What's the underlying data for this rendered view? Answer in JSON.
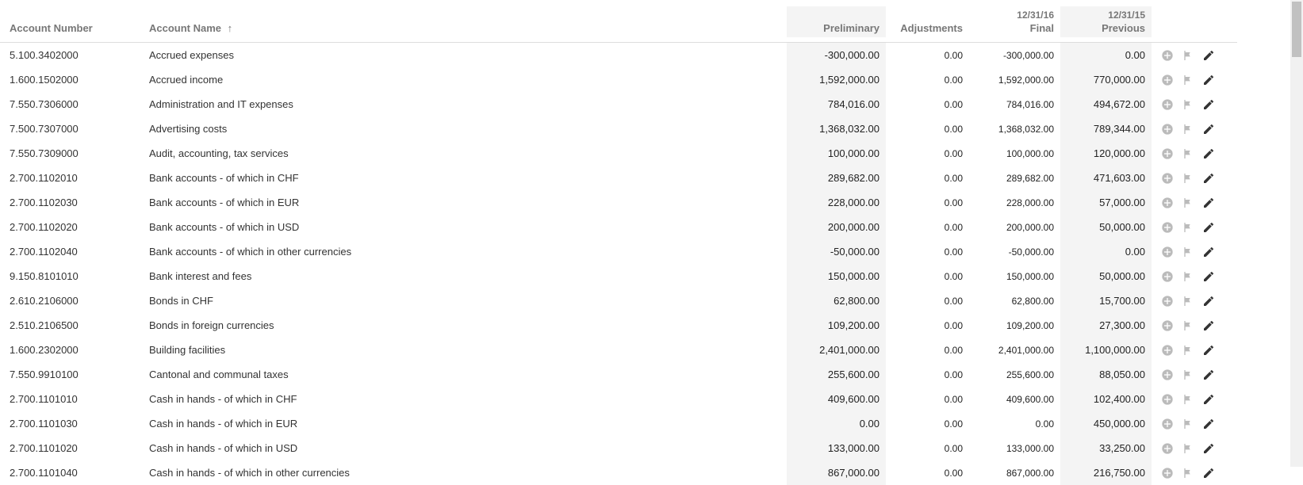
{
  "columns": {
    "account_number": "Account Number",
    "account_name": "Account Name",
    "preliminary": "Preliminary",
    "adjustments": "Adjustments",
    "final_super": "12/31/16",
    "final": "Final",
    "previous_super": "12/31/15",
    "previous": "Previous"
  },
  "sort": {
    "column": "account_name",
    "direction": "asc"
  },
  "rows": [
    {
      "num": "5.100.3402000",
      "name": "Accrued expenses",
      "prelim": "-300,000.00",
      "adj": "0.00",
      "final": "-300,000.00",
      "prev": "0.00"
    },
    {
      "num": "1.600.1502000",
      "name": "Accrued income",
      "prelim": "1,592,000.00",
      "adj": "0.00",
      "final": "1,592,000.00",
      "prev": "770,000.00"
    },
    {
      "num": "7.550.7306000",
      "name": "Administration and IT expenses",
      "prelim": "784,016.00",
      "adj": "0.00",
      "final": "784,016.00",
      "prev": "494,672.00"
    },
    {
      "num": "7.500.7307000",
      "name": "Advertising costs",
      "prelim": "1,368,032.00",
      "adj": "0.00",
      "final": "1,368,032.00",
      "prev": "789,344.00"
    },
    {
      "num": "7.550.7309000",
      "name": "Audit, accounting, tax services",
      "prelim": "100,000.00",
      "adj": "0.00",
      "final": "100,000.00",
      "prev": "120,000.00"
    },
    {
      "num": "2.700.1102010",
      "name": "Bank accounts - of which in CHF",
      "prelim": "289,682.00",
      "adj": "0.00",
      "final": "289,682.00",
      "prev": "471,603.00"
    },
    {
      "num": "2.700.1102030",
      "name": "Bank accounts - of which in EUR",
      "prelim": "228,000.00",
      "adj": "0.00",
      "final": "228,000.00",
      "prev": "57,000.00"
    },
    {
      "num": "2.700.1102020",
      "name": "Bank accounts - of which in USD",
      "prelim": "200,000.00",
      "adj": "0.00",
      "final": "200,000.00",
      "prev": "50,000.00"
    },
    {
      "num": "2.700.1102040",
      "name": "Bank accounts - of which in other currencies",
      "prelim": "-50,000.00",
      "adj": "0.00",
      "final": "-50,000.00",
      "prev": "0.00"
    },
    {
      "num": "9.150.8101010",
      "name": "Bank interest and fees",
      "prelim": "150,000.00",
      "adj": "0.00",
      "final": "150,000.00",
      "prev": "50,000.00"
    },
    {
      "num": "2.610.2106000",
      "name": "Bonds in CHF",
      "prelim": "62,800.00",
      "adj": "0.00",
      "final": "62,800.00",
      "prev": "15,700.00"
    },
    {
      "num": "2.510.2106500",
      "name": "Bonds in foreign currencies",
      "prelim": "109,200.00",
      "adj": "0.00",
      "final": "109,200.00",
      "prev": "27,300.00"
    },
    {
      "num": "1.600.2302000",
      "name": "Building facilities",
      "prelim": "2,401,000.00",
      "adj": "0.00",
      "final": "2,401,000.00",
      "prev": "1,100,000.00"
    },
    {
      "num": "7.550.9910100",
      "name": "Cantonal and communal taxes",
      "prelim": "255,600.00",
      "adj": "0.00",
      "final": "255,600.00",
      "prev": "88,050.00"
    },
    {
      "num": "2.700.1101010",
      "name": "Cash in hands - of which in CHF",
      "prelim": "409,600.00",
      "adj": "0.00",
      "final": "409,600.00",
      "prev": "102,400.00"
    },
    {
      "num": "2.700.1101030",
      "name": "Cash in hands - of which in EUR",
      "prelim": "0.00",
      "adj": "0.00",
      "final": "0.00",
      "prev": "450,000.00"
    },
    {
      "num": "2.700.1101020",
      "name": "Cash in hands - of which in USD",
      "prelim": "133,000.00",
      "adj": "0.00",
      "final": "133,000.00",
      "prev": "33,250.00"
    },
    {
      "num": "2.700.1101040",
      "name": "Cash in hands - of which in other currencies",
      "prelim": "867,000.00",
      "adj": "0.00",
      "final": "867,000.00",
      "prev": "216,750.00"
    }
  ],
  "icon_labels": {
    "add": "add",
    "flag": "flag",
    "edit": "edit"
  }
}
